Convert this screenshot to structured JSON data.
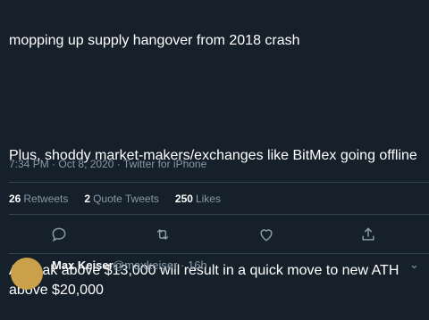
{
  "tweet": {
    "lines": [
      "mopping up supply hangover from 2018 crash",
      "Plus, shoddy market-makers/exchanges like BitMex going offline",
      "A break above $13,000 will result in a quick move to new ATH above $20,000"
    ],
    "time": "7:34 PM",
    "date": "Oct 8, 2020",
    "source": "Twitter for iPhone",
    "separator": "·"
  },
  "stats": {
    "retweets_count": "26",
    "retweets_label": "Retweets",
    "quotes_count": "2",
    "quotes_label": "Quote Tweets",
    "likes_count": "250",
    "likes_label": "Likes"
  },
  "actions": [
    "reply-icon",
    "retweet-icon",
    "like-icon",
    "share-icon"
  ],
  "reply": {
    "name": "Max Keiser",
    "handle": "@maxkeiser · 16h",
    "more": "⌄"
  },
  "colors": {
    "background": "#15202b",
    "text": "#ffffff",
    "secondary": "#8899a6",
    "divider": "#38444d"
  }
}
